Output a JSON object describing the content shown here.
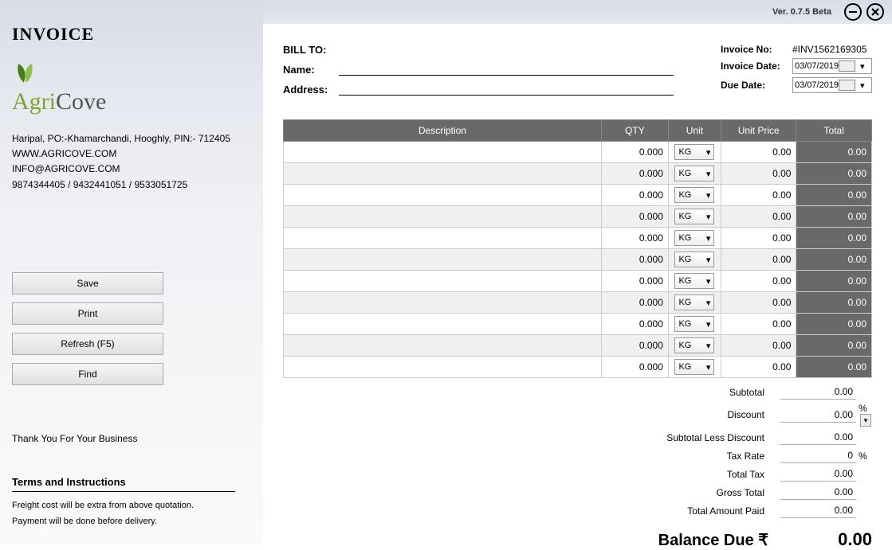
{
  "version": "Ver. 0.7.5 Beta",
  "title": "INVOICE",
  "brand": {
    "part1": "Agri",
    "part2": "Cove"
  },
  "company": {
    "address": "Haripal, PO:-Khamarchandi, Hooghly, PIN:- 712405",
    "website": "WWW.AGRICOVE.COM",
    "email": "INFO@AGRICOVE.COM",
    "phones": "9874344405 / 9432441051 / 9533051725"
  },
  "buttons": {
    "save": "Save",
    "print": "Print",
    "refresh": "Refresh (F5)",
    "find": "Find"
  },
  "thanks": "Thank You For Your Business",
  "terms": {
    "title": "Terms and Instructions",
    "line1": "Freight cost will be extra from above quotation.",
    "line2": "Payment will be done before delivery."
  },
  "bill": {
    "heading": "BILL TO:",
    "name_label": "Name:",
    "address_label": "Address:",
    "name": "",
    "address": ""
  },
  "meta": {
    "invoice_no_label": "Invoice No:",
    "invoice_no": "#INV1562169305",
    "invoice_date_label": "Invoice Date:",
    "invoice_date": "03/07/2019",
    "due_date_label": "Due Date:",
    "due_date": "03/07/2019"
  },
  "headers": {
    "desc": "Description",
    "qty": "QTY",
    "unit": "Unit",
    "price": "Unit Price",
    "total": "Total"
  },
  "rows": [
    {
      "desc": "",
      "qty": "0.000",
      "unit": "KG",
      "price": "0.00",
      "total": "0.00"
    },
    {
      "desc": "",
      "qty": "0.000",
      "unit": "KG",
      "price": "0.00",
      "total": "0.00"
    },
    {
      "desc": "",
      "qty": "0.000",
      "unit": "KG",
      "price": "0.00",
      "total": "0.00"
    },
    {
      "desc": "",
      "qty": "0.000",
      "unit": "KG",
      "price": "0.00",
      "total": "0.00"
    },
    {
      "desc": "",
      "qty": "0.000",
      "unit": "KG",
      "price": "0.00",
      "total": "0.00"
    },
    {
      "desc": "",
      "qty": "0.000",
      "unit": "KG",
      "price": "0.00",
      "total": "0.00"
    },
    {
      "desc": "",
      "qty": "0.000",
      "unit": "KG",
      "price": "0.00",
      "total": "0.00"
    },
    {
      "desc": "",
      "qty": "0.000",
      "unit": "KG",
      "price": "0.00",
      "total": "0.00"
    },
    {
      "desc": "",
      "qty": "0.000",
      "unit": "KG",
      "price": "0.00",
      "total": "0.00"
    },
    {
      "desc": "",
      "qty": "0.000",
      "unit": "KG",
      "price": "0.00",
      "total": "0.00"
    },
    {
      "desc": "",
      "qty": "0.000",
      "unit": "KG",
      "price": "0.00",
      "total": "0.00"
    }
  ],
  "totals": {
    "subtotal_label": "Subtotal",
    "subtotal": "0.00",
    "discount_label": "Discount",
    "discount": "0.00",
    "discount_unit": "%",
    "subtotal_less_label": "Subtotal Less Discount",
    "subtotal_less": "0.00",
    "tax_rate_label": "Tax Rate",
    "tax_rate": "0",
    "tax_rate_unit": "%",
    "total_tax_label": "Total Tax",
    "total_tax": "0.00",
    "gross_label": "Gross Total",
    "gross": "0.00",
    "paid_label": "Total Amount Paid",
    "paid": "0.00"
  },
  "balance": {
    "label": "Balance Due  ₹",
    "value": "0.00"
  }
}
